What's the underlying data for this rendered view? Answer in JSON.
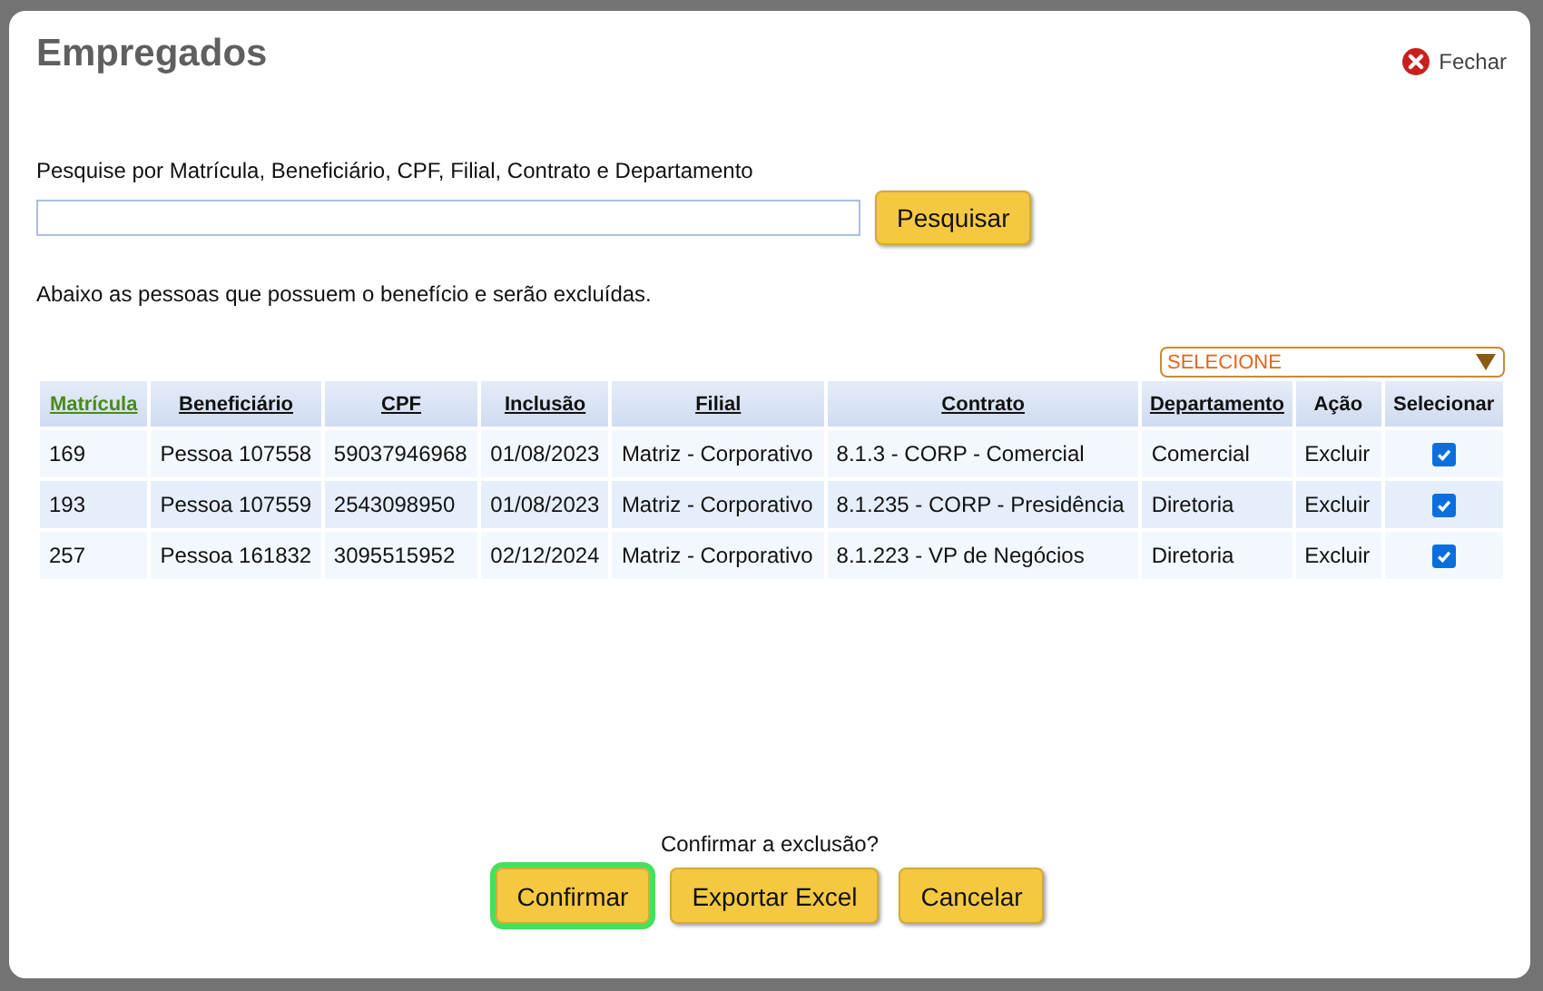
{
  "dialog": {
    "title": "Empregados",
    "close_label": "Fechar"
  },
  "search": {
    "label": "Pesquise por Matrícula, Beneficiário, CPF, Filial, Contrato e Departamento",
    "button": "Pesquisar"
  },
  "info": "Abaixo as pessoas que possuem o benefício e serão excluídas.",
  "filter": {
    "value": "SELECIONE"
  },
  "table": {
    "columns": [
      {
        "label": "Matrícula",
        "sortable": true,
        "sorted": true
      },
      {
        "label": "Beneficiário",
        "sortable": true,
        "sorted": false
      },
      {
        "label": "CPF",
        "sortable": true,
        "sorted": false
      },
      {
        "label": "Inclusão",
        "sortable": true,
        "sorted": false
      },
      {
        "label": "Filial",
        "sortable": true,
        "sorted": false
      },
      {
        "label": "Contrato",
        "sortable": true,
        "sorted": false
      },
      {
        "label": "Departamento",
        "sortable": true,
        "sorted": false
      },
      {
        "label": "Ação",
        "sortable": false,
        "sorted": false
      },
      {
        "label": "Selecionar",
        "sortable": false,
        "sorted": false
      }
    ],
    "rows": [
      {
        "cells": [
          "169",
          "Pessoa 107558",
          "59037946968",
          "01/08/2023",
          "Matriz - Corporativo",
          "8.1.3 - CORP - Comercial",
          "Comercial"
        ],
        "action": "Excluir",
        "checked": true
      },
      {
        "cells": [
          "193",
          "Pessoa 107559",
          "2543098950",
          "01/08/2023",
          "Matriz - Corporativo",
          "8.1.235 - CORP - Presidência",
          "Diretoria"
        ],
        "action": "Excluir",
        "checked": true
      },
      {
        "cells": [
          "257",
          "Pessoa 161832",
          "3095515952",
          "02/12/2024",
          "Matriz - Corporativo",
          "8.1.223 - VP de Negócios",
          "Diretoria"
        ],
        "action": "Excluir",
        "checked": true
      }
    ]
  },
  "confirm": {
    "question": "Confirmar a exclusão?",
    "buttons": [
      {
        "label": "Confirmar",
        "focused": true
      },
      {
        "label": "Exportar Excel",
        "focused": false
      },
      {
        "label": "Cancelar",
        "focused": false
      }
    ]
  }
}
